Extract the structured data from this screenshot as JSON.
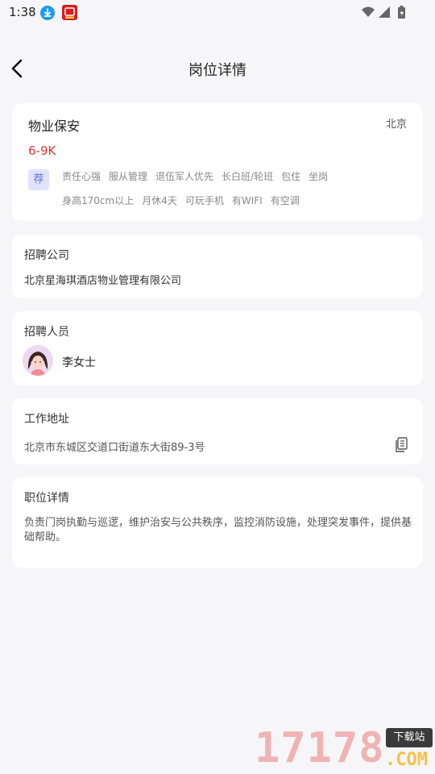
{
  "status_bar": {
    "time": "1:38"
  },
  "header": {
    "title": "岗位详情"
  },
  "job": {
    "title": "物业保安",
    "city": "北京",
    "salary": "6-9K",
    "badge": "荐",
    "tags": [
      "责任心强",
      "服从管理",
      "退伍军人优先",
      "长白班/轮班",
      "包住",
      "坐岗",
      "身高170cm以上",
      "月休4天",
      "可玩手机",
      "有WIFI",
      "有空调"
    ]
  },
  "company": {
    "label": "招聘公司",
    "name": "北京星海琪酒店物业管理有限公司"
  },
  "recruiter": {
    "label": "招聘人员",
    "name": "李女士"
  },
  "address": {
    "label": "工作地址",
    "value": "北京市东城区交道口街道东大街89-3号"
  },
  "description": {
    "label": "职位详情",
    "text": "负责门岗执勤与巡逻，维护治安与公共秩序，监控消防设施，处理突发事件，提供基础帮助。"
  },
  "watermark": {
    "number": "17178",
    "tag": "下载站",
    "domain": ".COM"
  },
  "colors": {
    "salary": "#e53935",
    "badge_bg": "#dfe3ff",
    "badge_text": "#6273e0",
    "page_bg": "#f6f6f8"
  }
}
